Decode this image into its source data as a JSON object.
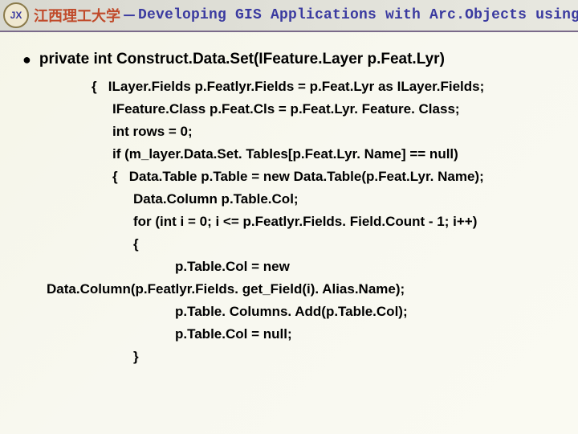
{
  "header": {
    "university": "江西理工大学",
    "dash": "－",
    "course": "Developing GIS Applications with Arc.Objects using C#. NE",
    "logo_text": "JX"
  },
  "bullet": "●",
  "signature": "private int Construct.Data.Set(IFeature.Layer p.Feat.Lyr)",
  "code": {
    "l1": "{   ILayer.Fields p.Featlyr.Fields = p.Feat.Lyr as ILayer.Fields;",
    "l2": "IFeature.Class p.Feat.Cls = p.Feat.Lyr. Feature. Class;",
    "l3": "int rows = 0;",
    "l4": "if (m_layer.Data.Set. Tables[p.Feat.Lyr. Name] == null)",
    "l5": "{   Data.Table p.Table = new Data.Table(p.Feat.Lyr. Name);",
    "l6": "Data.Column p.Table.Col;",
    "l7": "for (int i = 0; i <= p.Featlyr.Fields. Field.Count - 1; i++)",
    "l8": "{",
    "l9a": "p.Table.Col = new",
    "l9b": "Data.Column(p.Featlyr.Fields. get_Field(i). Alias.Name);",
    "l10": "p.Table. Columns. Add(p.Table.Col);",
    "l11": "p.Table.Col = null;",
    "l12": "}"
  }
}
